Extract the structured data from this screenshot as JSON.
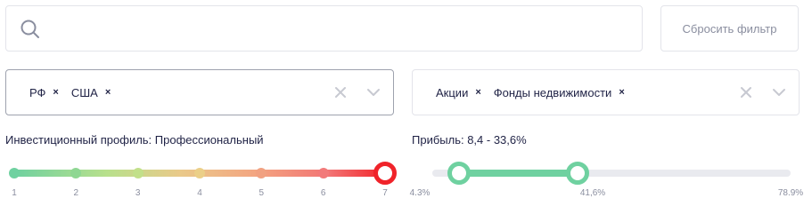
{
  "search": {
    "placeholder": "",
    "value": ""
  },
  "reset_button": {
    "label": "Сбросить фильтр"
  },
  "country_filter": {
    "chips": [
      {
        "label": "РФ",
        "remove": "×"
      },
      {
        "label": "США",
        "remove": "×"
      }
    ]
  },
  "type_filter": {
    "chips": [
      {
        "label": "Акции",
        "remove": "×"
      },
      {
        "label": "Фонды недвижимости",
        "remove": "×"
      }
    ]
  },
  "profile_slider": {
    "label": "Инвестиционный профиль: Профессиональный",
    "ticks": [
      "1",
      "2",
      "3",
      "4",
      "5",
      "6",
      "7"
    ],
    "dot_colors": [
      "#6fd1a0",
      "#8fd793",
      "#c2e08a",
      "#ebcf88",
      "#f1a181",
      "#f27a7a",
      "#f0232a"
    ],
    "selected_index": 6
  },
  "profit_slider": {
    "label": "Прибыль: 8,4 - 33,6%",
    "min": 4.3,
    "max": 78.9,
    "low_value": 8.4,
    "high_value": 33.6,
    "ticks": [
      "4.3%",
      "41,6%",
      "78.9%"
    ]
  }
}
